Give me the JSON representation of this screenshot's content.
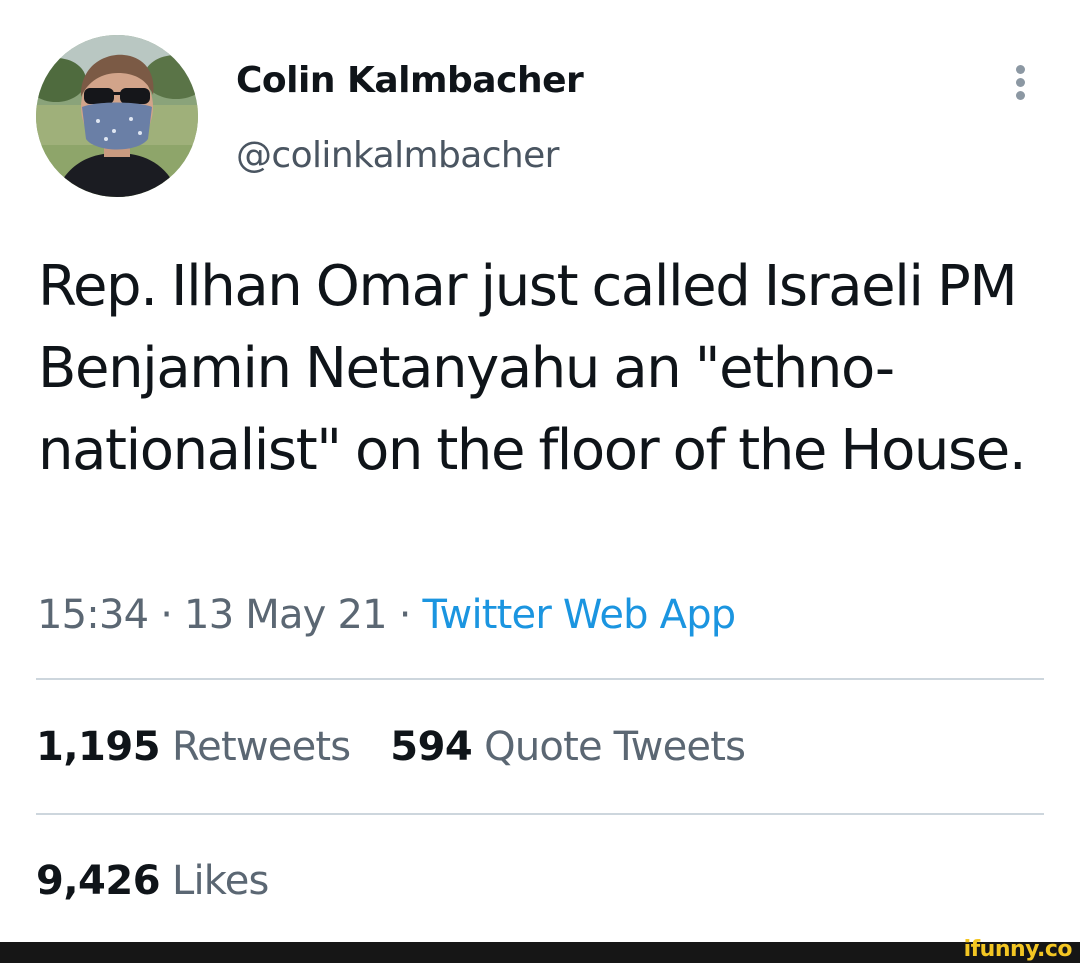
{
  "author": {
    "display_name": "Colin Kalmbacher",
    "handle": "@colinkalmbacher",
    "avatar_icon": "profile-photo-masked-man"
  },
  "menu": {
    "icon": "more-vertical-icon"
  },
  "tweet": {
    "text": "Rep. Ilhan Omar just called Israeli PM Benjamin Netanyahu an \"ethno-nationalist\" on the floor of the House.",
    "time": "15:34",
    "date": "13 May 21",
    "separator": "·",
    "source": "Twitter Web App"
  },
  "stats": {
    "retweets": {
      "count": "1,195",
      "label": "Retweets"
    },
    "quote_tweets": {
      "count": "594",
      "label": "Quote Tweets"
    },
    "likes": {
      "count": "9,426",
      "label": "Likes"
    }
  },
  "watermark": {
    "text": "ifunny.co"
  },
  "colors": {
    "background": "#ffffff",
    "text_primary": "#0f1419",
    "text_secondary": "#5b6773",
    "link": "#1b95e0",
    "divider": "#cdd6dd",
    "footer": "#161616",
    "watermark": "#f3c623"
  }
}
